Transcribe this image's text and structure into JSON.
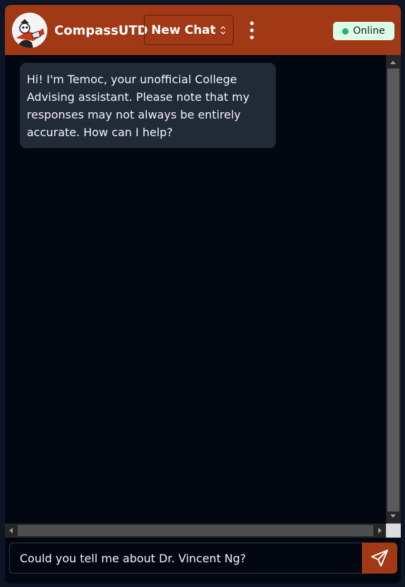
{
  "header": {
    "brand": "CompassUTD",
    "new_chat_label": "New Chat",
    "status_label": "Online",
    "avatar_icon": "temoc-mascot-avatar",
    "chevron_icon": "chevron-up-down-icon",
    "menu_icon": "vertical-dots-icon"
  },
  "messages": [
    {
      "sender": "assistant",
      "text": "Hi! I'm Temoc, your unofficial College Advising assistant. Please note that my responses may not always be entirely accurate. How can I help?"
    }
  ],
  "composer": {
    "value": "Could you tell me about Dr. Vincent Ng?",
    "send_icon": "paper-plane-icon"
  },
  "colors": {
    "header_bg": "#a13816",
    "chat_bg": "#020711",
    "bubble_bg": "#212a37",
    "status_bg": "#dcfce7",
    "status_dot": "#22b26b",
    "send_bg": "#a13816"
  }
}
